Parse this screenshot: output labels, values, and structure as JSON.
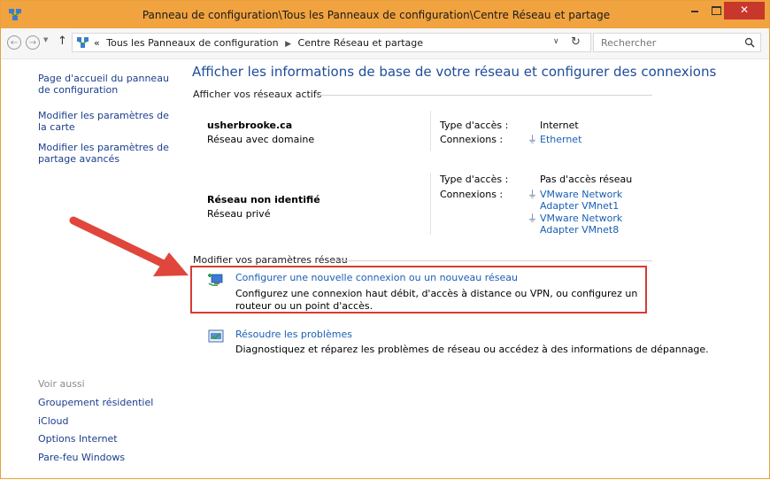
{
  "window": {
    "title": "Panneau de configuration\\Tous les Panneaux de configuration\\Centre Réseau et partage",
    "minimize": "–",
    "maximize": "□",
    "close": "✕"
  },
  "addressbar": {
    "overflow": "«",
    "crumbs": [
      "Tous les Panneaux de configuration",
      "Centre Réseau et partage"
    ],
    "search_placeholder": "Rechercher"
  },
  "sidebar": {
    "items": [
      {
        "label": "Page d'accueil du panneau de configuration"
      },
      {
        "label": "Modifier les paramètres de la carte"
      },
      {
        "label": "Modifier les paramètres de partage avancés"
      }
    ],
    "see_also_label": "Voir aussi",
    "see_also": [
      {
        "label": "Groupement résidentiel"
      },
      {
        "label": "iCloud"
      },
      {
        "label": "Options Internet"
      },
      {
        "label": "Pare-feu Windows"
      }
    ]
  },
  "main": {
    "heading": "Afficher les informations de base de votre réseau et configurer des connexions",
    "active_networks_title": "Afficher vos réseaux actifs",
    "networks": [
      {
        "name": "usherbrooke.ca",
        "type": "Réseau avec domaine",
        "access_label": "Type d'accès :",
        "access_value": "Internet",
        "connections_label": "Connexions :",
        "connections": [
          "Ethernet"
        ]
      },
      {
        "name": "Réseau non identifié",
        "type": "Réseau privé",
        "access_label": "Type d'accès :",
        "access_value": "Pas d'accès réseau",
        "connections_label": "Connexions :",
        "connections": [
          "VMware Network Adapter VMnet1",
          "VMware Network Adapter VMnet8"
        ]
      }
    ],
    "change_settings_title": "Modifier vos paramètres réseau",
    "tasks": [
      {
        "link": "Configurer une nouvelle connexion ou un nouveau réseau",
        "description": "Configurez une connexion haut débit, d'accès à distance ou VPN, ou configurez un routeur ou un point d'accès."
      },
      {
        "link": "Résoudre les problèmes",
        "description": "Diagnostiquez et réparez les problèmes de réseau ou accédez à des informations de dépannage."
      }
    ]
  },
  "colors": {
    "titlebar": "#f1a33f",
    "link": "#1a5fb4",
    "heading": "#1e4c9a",
    "highlight": "#d83b33"
  },
  "icons": [
    "network-center-icon",
    "back-icon",
    "forward-icon",
    "up-icon",
    "refresh-icon",
    "search-icon",
    "plug-icon",
    "new-connection-icon",
    "troubleshoot-icon"
  ]
}
